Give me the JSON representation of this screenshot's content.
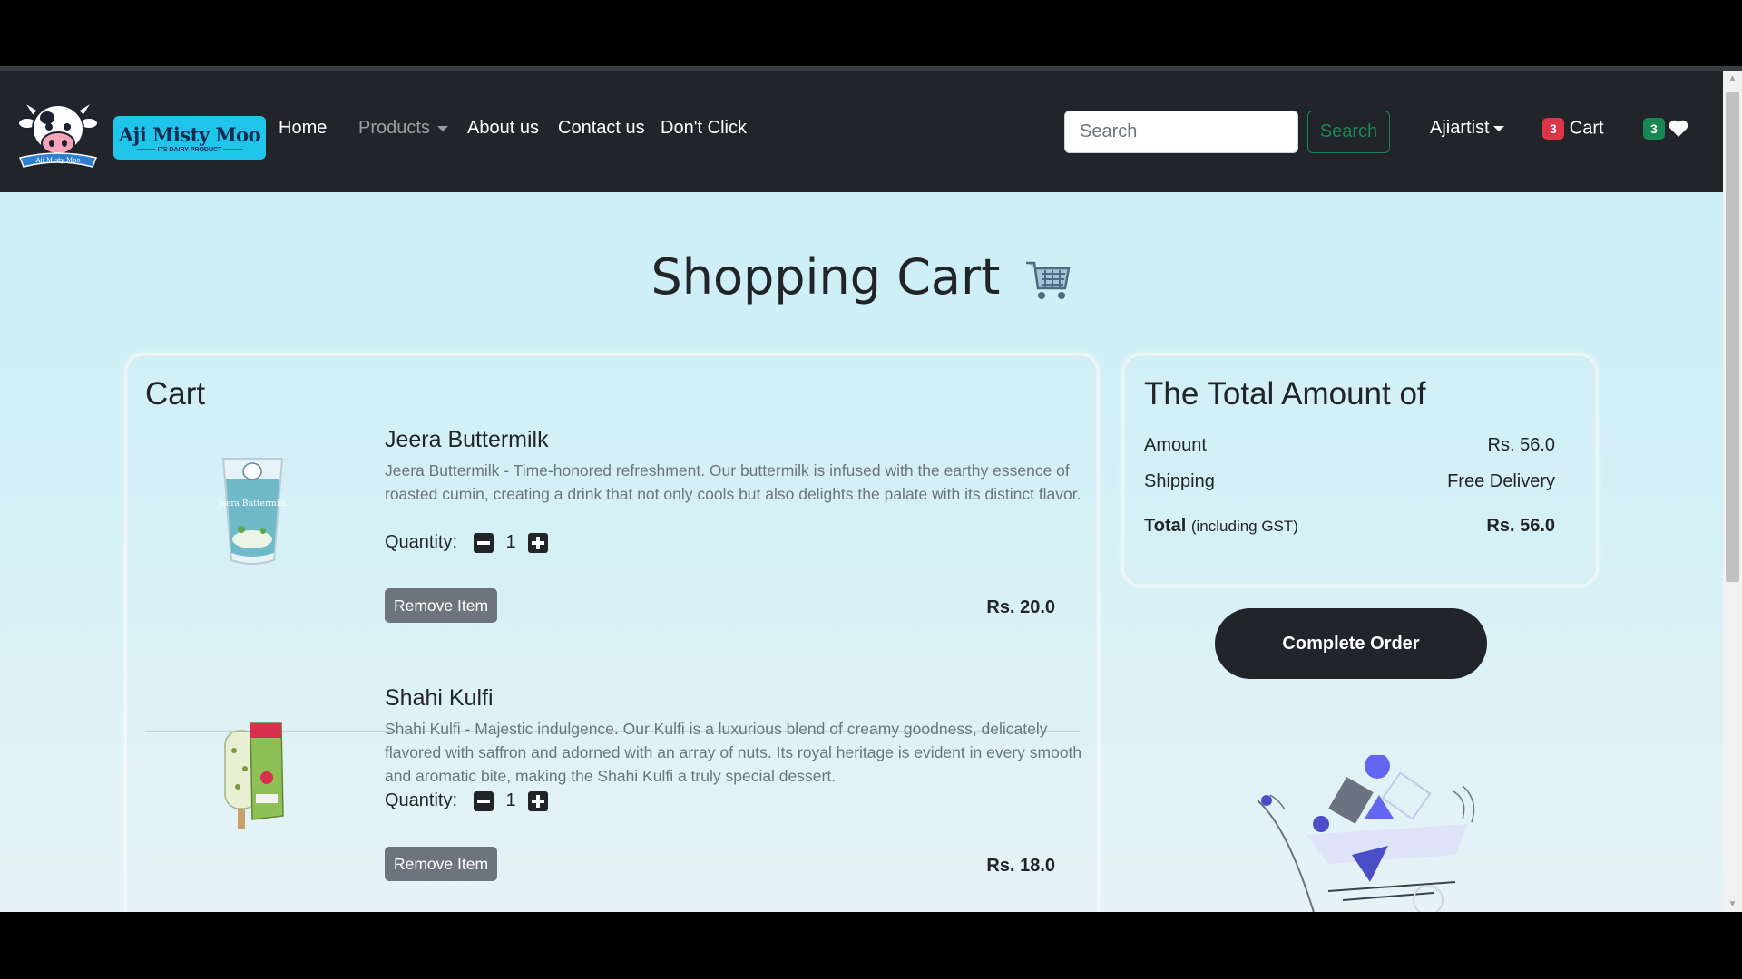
{
  "nav": {
    "brand_title": "Aji Misty Moo",
    "brand_subtitle": "ITS DAIRY PRODUCT",
    "brand_cow_banner": "Aji Misty Moo",
    "links": {
      "home": "Home",
      "products": "Products",
      "about": "About us",
      "contact": "Contact us",
      "dont_click": "Don't Click"
    },
    "search_placeholder": "Search",
    "search_button": "Search",
    "user": "Ajiartist",
    "cart_count": "3",
    "cart_label": "Cart",
    "wishlist_count": "3"
  },
  "page": {
    "title": "Shopping Cart"
  },
  "cart": {
    "heading": "Cart",
    "quantity_label": "Quantity:",
    "remove_label": "Remove Item",
    "items": [
      {
        "name": "Jeera Buttermilk",
        "description": "Jeera Buttermilk - Time-honored refreshment. Our buttermilk is infused with the earthy essence of roasted cumin, creating a drink that not only cools but also delights the palate with its distinct flavor.",
        "quantity": "1",
        "price": "Rs. 20.0",
        "image_label": "Jeera Buttermilk"
      },
      {
        "name": "Shahi Kulfi",
        "description": "Shahi Kulfi - Majestic indulgence. Our Kulfi is a luxurious blend of creamy goodness, delicately flavored with saffron and adorned with an array of nuts. Its royal heritage is evident in every smooth and aromatic bite, making the Shahi Kulfi a truly special dessert.",
        "quantity": "1",
        "price": "Rs. 18.0"
      }
    ]
  },
  "summary": {
    "heading": "The Total Amount of",
    "amount_label": "Amount",
    "amount_value": "Rs. 56.0",
    "shipping_label": "Shipping",
    "shipping_value": "Free Delivery",
    "total_label": "Total",
    "total_note": "(including GST)",
    "total_value": "Rs. 56.0"
  },
  "complete_order": "Complete Order",
  "colors": {
    "navbar": "#212529",
    "brand_badge": "#20c5ea",
    "search_green": "#198754",
    "badge_red": "#dc3545",
    "remove_gray": "#6c757d"
  }
}
